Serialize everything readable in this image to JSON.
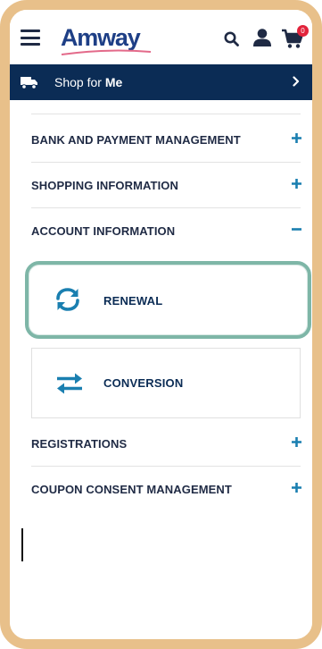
{
  "header": {
    "logo_text": "Amway",
    "cart_count": "0",
    "icons": [
      "menu-icon",
      "search-icon",
      "user-icon",
      "cart-icon"
    ]
  },
  "shop_bar": {
    "prefix": "Shop for ",
    "who": "Me",
    "icons": [
      "truck-icon",
      "chevron-right-icon"
    ]
  },
  "menu": {
    "items": [
      {
        "label": "BANK AND PAYMENT MANAGEMENT",
        "toggle": "+"
      },
      {
        "label": "SHOPPING INFORMATION",
        "toggle": "+"
      },
      {
        "label": "ACCOUNT INFORMATION",
        "toggle": "−"
      },
      {
        "label": "REGISTRATIONS",
        "toggle": "+"
      },
      {
        "label": "COUPON CONSENT MANAGEMENT",
        "toggle": "+"
      }
    ],
    "sub_items": [
      {
        "label": "RENEWAL",
        "icon": "refresh-icon"
      },
      {
        "label": "CONVERSION",
        "icon": "swap-arrows-icon"
      }
    ]
  },
  "colors": {
    "navy": "#0b2c55",
    "accent_blue": "#1a7fb0",
    "highlight": "#7eb6a7",
    "frame": "#e8c08a",
    "badge": "#e2233b"
  }
}
